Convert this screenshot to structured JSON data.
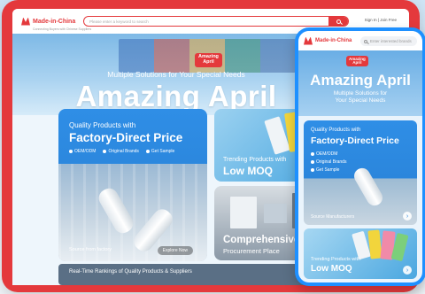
{
  "brand": {
    "name": "Made-in-China",
    "tagline": "Connecting Buyers with Chinese Suppliers",
    "accent_color": "#e4393c",
    "phone_frame_color": "#1e90ff",
    "card_blue": "#2b86dc"
  },
  "desktop": {
    "search": {
      "placeholder": "Please enter a keyword to search"
    },
    "signin": "Sign In | Join Free",
    "hero": {
      "badge_line1": "Amazing",
      "badge_line2": "April",
      "subtitle": "Multiple Solutions for Your Special Needs",
      "title": "Amazing April"
    },
    "card_factory": {
      "kicker": "Quality Products with",
      "title": "Factory-Direct Price",
      "tags": [
        "OEM/ODM",
        "Original Brands",
        "Get Sample"
      ],
      "footer": "Source from factory",
      "button": "Explore Now"
    },
    "card_moq": {
      "kicker": "Trending Products with",
      "title": "Low MOQ"
    },
    "card_procurement": {
      "title": "Comprehensive",
      "subtitle": "Procurement Place"
    },
    "rankings": {
      "label": "Real-Time Rankings of Quality Products & Suppliers"
    }
  },
  "mobile": {
    "search": {
      "placeholder": "Enter interested brands"
    },
    "hero": {
      "badge_line1": "Amazing",
      "badge_line2": "April",
      "title": "Amazing April",
      "subtitle_line1": "Multiple Solutions for",
      "subtitle_line2": "Your Special Needs"
    },
    "card_factory": {
      "kicker": "Quality Products with",
      "title": "Factory-Direct Price",
      "tags": [
        "OEM/ODM",
        "Original Brands",
        "Get Sample"
      ],
      "footer": "Source Manufacturers"
    },
    "card_moq": {
      "kicker": "Trending Products with",
      "title": "Low MOQ"
    },
    "arrow_glyph": "›"
  }
}
